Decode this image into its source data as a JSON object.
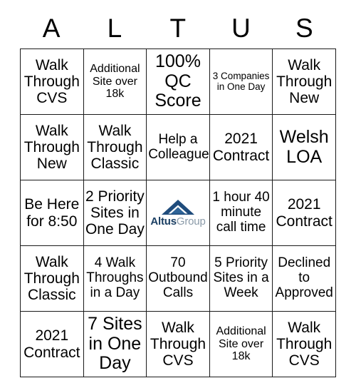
{
  "card": {
    "title_letters": [
      "A",
      "L",
      "T",
      "U",
      "S"
    ],
    "rows": [
      [
        {
          "text": "Walk Through CVS",
          "size": "t-lg",
          "kind": "text"
        },
        {
          "text": "Additional Site over 18k",
          "size": "t-sm",
          "kind": "text"
        },
        {
          "text": "100% QC Score",
          "size": "t-xl",
          "kind": "text"
        },
        {
          "text": "3 Companies in One Day",
          "size": "t-xs",
          "kind": "text"
        },
        {
          "text": "Walk Through New",
          "size": "t-lg",
          "kind": "text"
        }
      ],
      [
        {
          "text": "Walk Through New",
          "size": "t-lg",
          "kind": "text"
        },
        {
          "text": "Walk Through Classic",
          "size": "t-lg",
          "kind": "text"
        },
        {
          "text": "Help a Colleague",
          "size": "t-md",
          "kind": "text"
        },
        {
          "text": "2021 Contract",
          "size": "t-lg",
          "kind": "text"
        },
        {
          "text": "Welsh LOA",
          "size": "t-xl",
          "kind": "text"
        }
      ],
      [
        {
          "text": "Be Here for 8:50",
          "size": "t-lg",
          "kind": "text"
        },
        {
          "text": "2 Priority Sites in One Day",
          "size": "t-lg",
          "kind": "text"
        },
        {
          "text": "",
          "size": "t-md",
          "kind": "logo"
        },
        {
          "text": "1 hour 40 minute call time",
          "size": "t-md",
          "kind": "text"
        },
        {
          "text": "2021 Contract",
          "size": "t-lg",
          "kind": "text"
        }
      ],
      [
        {
          "text": "Walk Through Classic",
          "size": "t-lg",
          "kind": "text"
        },
        {
          "text": "4 Walk Throughs in a Day",
          "size": "t-md",
          "kind": "text"
        },
        {
          "text": "70 Outbound Calls",
          "size": "t-md",
          "kind": "text"
        },
        {
          "text": "5 Priority Sites in a Week",
          "size": "t-md",
          "kind": "text"
        },
        {
          "text": "Declined to Approved",
          "size": "t-md",
          "kind": "text"
        }
      ],
      [
        {
          "text": "2021 Contract",
          "size": "t-lg",
          "kind": "text"
        },
        {
          "text": "7 Sites in One Day",
          "size": "t-xl",
          "kind": "text"
        },
        {
          "text": "Walk Through CVS",
          "size": "t-lg",
          "kind": "text"
        },
        {
          "text": "Additional Site over 18k",
          "size": "t-sm",
          "kind": "text"
        },
        {
          "text": "Walk Through CVS",
          "size": "t-lg",
          "kind": "text"
        }
      ]
    ],
    "logo": {
      "name": "altus-group-logo",
      "word_primary": "Altus",
      "word_secondary": "Group",
      "color_primary": "#1b3f63",
      "color_secondary": "#8a9aa8",
      "mark_color_dark": "#1f4c7c",
      "mark_color_mid": "#2f6498"
    },
    "colors": {
      "border": "#1a1a1a",
      "text": "#000000",
      "background": "#ffffff"
    }
  }
}
